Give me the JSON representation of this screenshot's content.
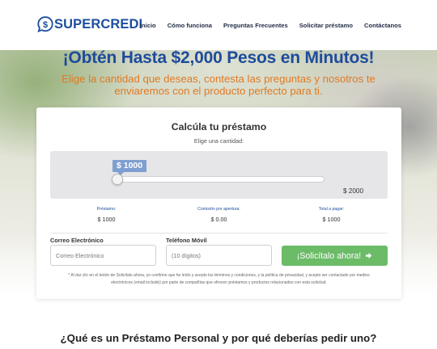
{
  "header": {
    "logo_text": "SUPERCREDI",
    "brand_color": "#1c4e9e",
    "nav": [
      {
        "label": "Inicio"
      },
      {
        "label": "Cómo funciona"
      },
      {
        "label": "Preguntas Frecuentes"
      },
      {
        "label": "Solicitar préstamo"
      },
      {
        "label": "Contáctanos"
      }
    ]
  },
  "hero": {
    "title": "¡Obtén Hasta $2,000 Pesos en Minutos!",
    "subtitle": "Elige la cantidad que deseas, contesta las preguntas y nosotros te enviaremos con el producto perfecto para ti.",
    "title_color": "#1e4b9c",
    "subtitle_color": "#e07a25"
  },
  "calculator": {
    "title": "Calcúla tu préstamo",
    "instruction": "Elige una cantidad:",
    "slider": {
      "current_label": "$ 1000",
      "max_label": "$ 2000",
      "value": 1000,
      "max": 2000
    },
    "summary": [
      {
        "label": "Préstamo:",
        "value": "$ 1000"
      },
      {
        "label": "Comisión por apertura:",
        "value": "$ 0.00"
      },
      {
        "label": "Total a pagar:",
        "value": "$ 1000"
      }
    ]
  },
  "form": {
    "email_label": "Correo Electrónico",
    "email_placeholder": "Correo Electrónico",
    "phone_label": "Teléfono Móvil",
    "phone_placeholder": "(10 dígitos)",
    "submit_label": "¡Solicítalo ahora!",
    "submit_color": "#6bbb67",
    "disclaimer": "* Al dar clic en el botón de Solicítalo ahora, yo confirmo que he leído y acepto los términos y condiciones, y la política de privacidad, y acepto ser contactado por medios electrónicos (email incluido) por parte de compañías que ofrecen préstamos y productos relacionados con esta solicitud."
  },
  "section": {
    "title": "¿Qué es un Préstamo Personal y por qué deberías pedir uno?"
  }
}
